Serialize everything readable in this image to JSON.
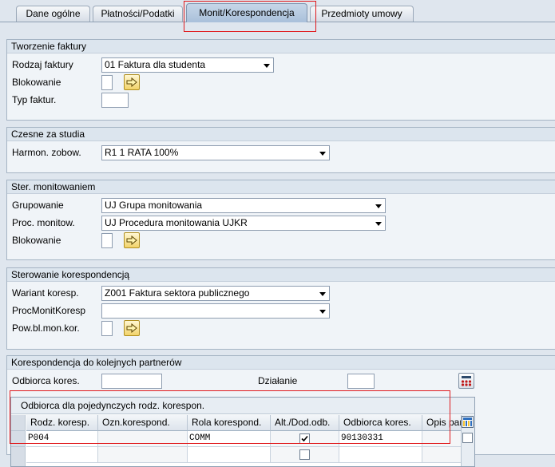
{
  "tabs": [
    {
      "label": "Dane ogólne",
      "active": false
    },
    {
      "label": "Płatności/Podatki",
      "active": false
    },
    {
      "label": "Monit/Korespondencja",
      "active": true
    },
    {
      "label": "Przedmioty umowy",
      "active": false
    }
  ],
  "faktura": {
    "title": "Tworzenie faktury",
    "rodzaj_label": "Rodzaj faktury",
    "rodzaj_value": "01 Faktura dla studenta",
    "blokowanie_label": "Blokowanie",
    "blokowanie_value": "",
    "typ_label": "Typ faktur.",
    "typ_value": ""
  },
  "czesne": {
    "title": "Czesne za studia",
    "harmon_label": "Harmon. zobow.",
    "harmon_value": "R1 1 RATA 100%"
  },
  "monit": {
    "title": "Ster. monitowaniem",
    "grupowanie_label": "Grupowanie",
    "grupowanie_value": "UJ Grupa monitowania",
    "proc_label": "Proc. monitow.",
    "proc_value": "UJ Procedura monitowania UJKR",
    "blokowanie_label": "Blokowanie",
    "blokowanie_value": ""
  },
  "koresp": {
    "title": "Sterowanie korespondencją",
    "wariant_label": "Wariant koresp.",
    "wariant_value": "Z001 Faktura sektora publicznego",
    "procmonit_label": "ProcMonitKoresp",
    "procmonit_value": "",
    "powbl_label": "Pow.bl.mon.kor.",
    "powbl_value": ""
  },
  "partnerzy": {
    "title": "Korespondencja do kolejnych partnerów",
    "odbiorca_label": "Odbiorca kores.",
    "odbiorca_value": "",
    "dzialanie_label": "Działanie",
    "dzialanie_value": "",
    "table": {
      "title": "Odbiorca dla pojedynczych rodz. korespon.",
      "columns": [
        "Rodz. koresp.",
        "Ozn.korespond.",
        "Rola korespond.",
        "Alt./Dod.odb.",
        "Odbiorca kores.",
        "Opis par"
      ],
      "rows": [
        {
          "rodz": "P004",
          "ozn": "",
          "rola": "COMM",
          "alt_checked": true,
          "odbiorca": "90130331",
          "opis": ""
        }
      ]
    }
  }
}
